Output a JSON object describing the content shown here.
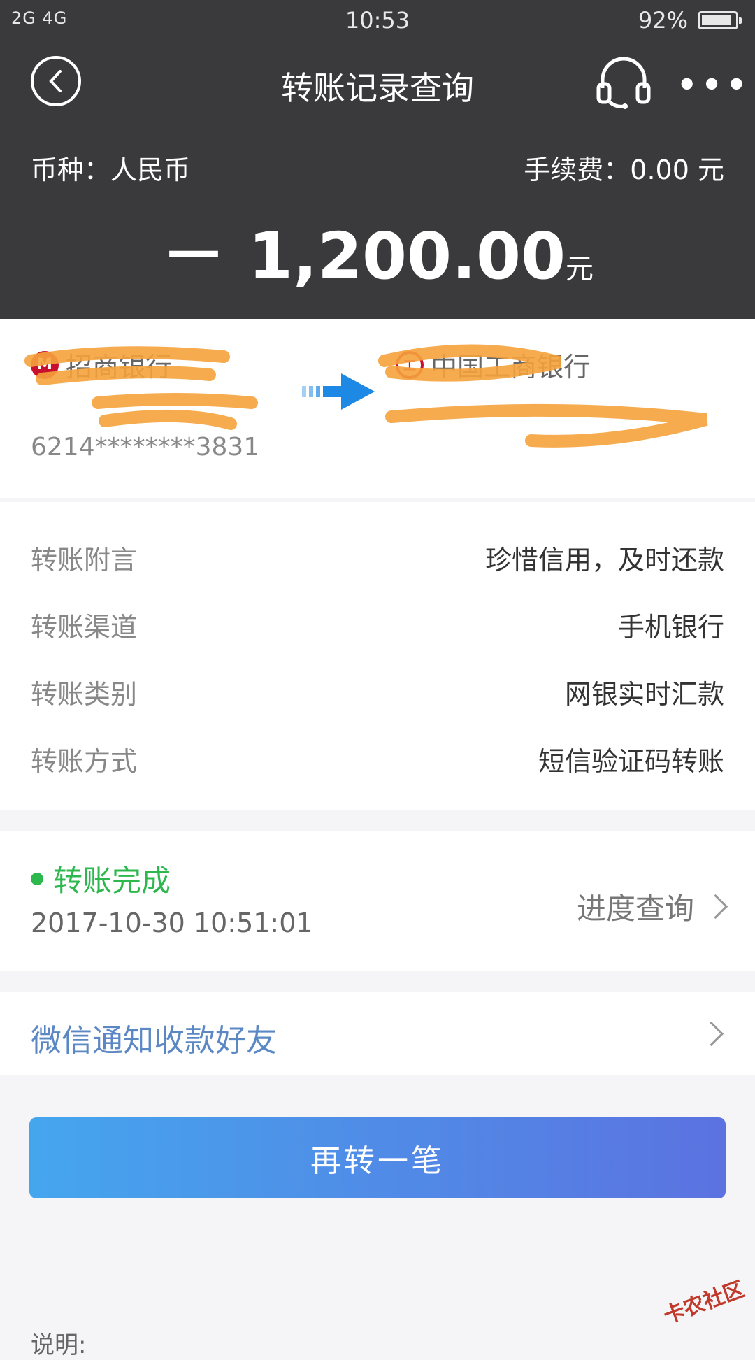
{
  "status_bar": {
    "signal": "2G 4G",
    "time": "10:53",
    "battery": "92%",
    "battery_level": 0.92
  },
  "header": {
    "title": "转账记录查询",
    "currency": "币种：人民币",
    "fee": "手续费：0.00 元",
    "amount": "－ 1,200.00",
    "amount_unit": "元"
  },
  "transfer": {
    "from": {
      "bank": "招商银行",
      "holder": "",
      "account": "6214********3831"
    },
    "to": {
      "bank": "中国工商银行",
      "holder": "",
      "account": ""
    }
  },
  "details": [
    {
      "key": "转账附言",
      "value": "珍惜信用，及时还款"
    },
    {
      "key": "转账渠道",
      "value": "手机银行"
    },
    {
      "key": "转账类别",
      "value": "网银实时汇款"
    },
    {
      "key": "转账方式",
      "value": "短信验证码转账"
    }
  ],
  "status": {
    "label": "转账完成",
    "datetime": "2017-10-30 10:51:01",
    "progress_link": "进度查询"
  },
  "wechat_notify": "微信通知收款好友",
  "again_button": "再转一笔",
  "footer_note": "说明:",
  "watermark": "卡农社区",
  "colors": {
    "header_bg": "#3a3a3c",
    "success": "#2db84d",
    "link": "#5b88c4",
    "button_start": "#45a6ee",
    "button_end": "#5b72e0"
  }
}
